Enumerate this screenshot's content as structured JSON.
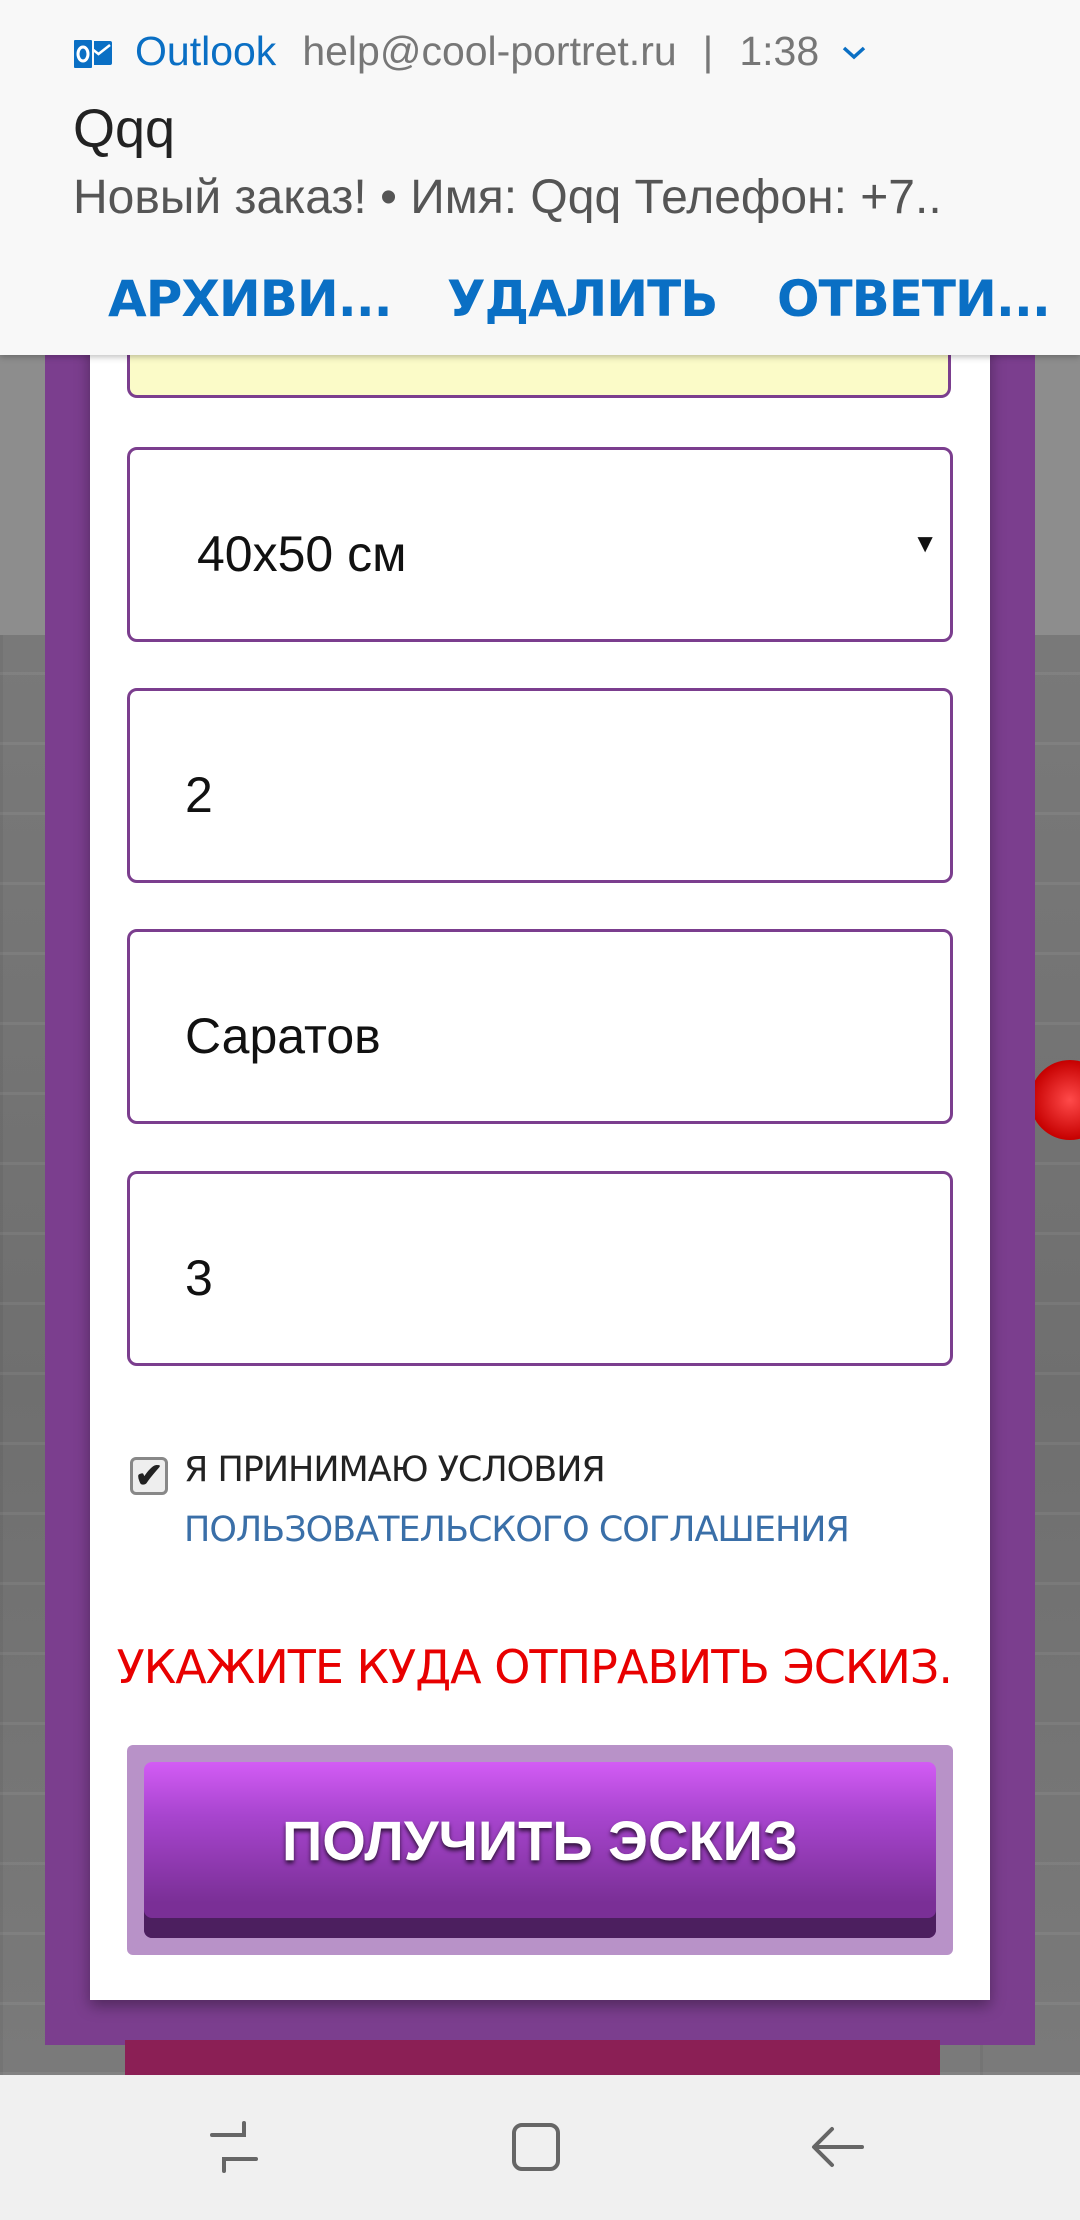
{
  "notification": {
    "app": "Outlook",
    "sender": "help@cool-portret.ru",
    "separator": "|",
    "time": "1:38",
    "title": "Qqq",
    "body": "Новый заказ! • Имя: Qqq Телефон: +7..",
    "actions": [
      "АРХИВИ...",
      "УДАЛИТЬ",
      "ОТВЕТИ..."
    ]
  },
  "form": {
    "size_select": "40x50 см",
    "field_2": "2",
    "field_city": "Саратов",
    "field_3": "3",
    "agree_text": "Я принимаю условия ",
    "agree_link": "пользовательского соглашения",
    "checkbox_checked": true,
    "warning": "УКАЖИТЕ КУДА ОТПРАВИТЬ ЭСКИЗ.",
    "submit_label": "ПОЛУЧИТЬ ЭСКИЗ"
  },
  "icons": {
    "notification_app": "outlook-icon",
    "expand": "chevron-down-icon",
    "select_arrow": "triangle-down-icon",
    "nav_recent": "recent-apps-icon",
    "nav_home": "home-icon",
    "nav_back": "back-icon"
  },
  "colors": {
    "purple": "#7b3e8e",
    "link": "#3a6fa8",
    "warning": "#e80000",
    "outlook_blue": "#0a6fc4"
  }
}
